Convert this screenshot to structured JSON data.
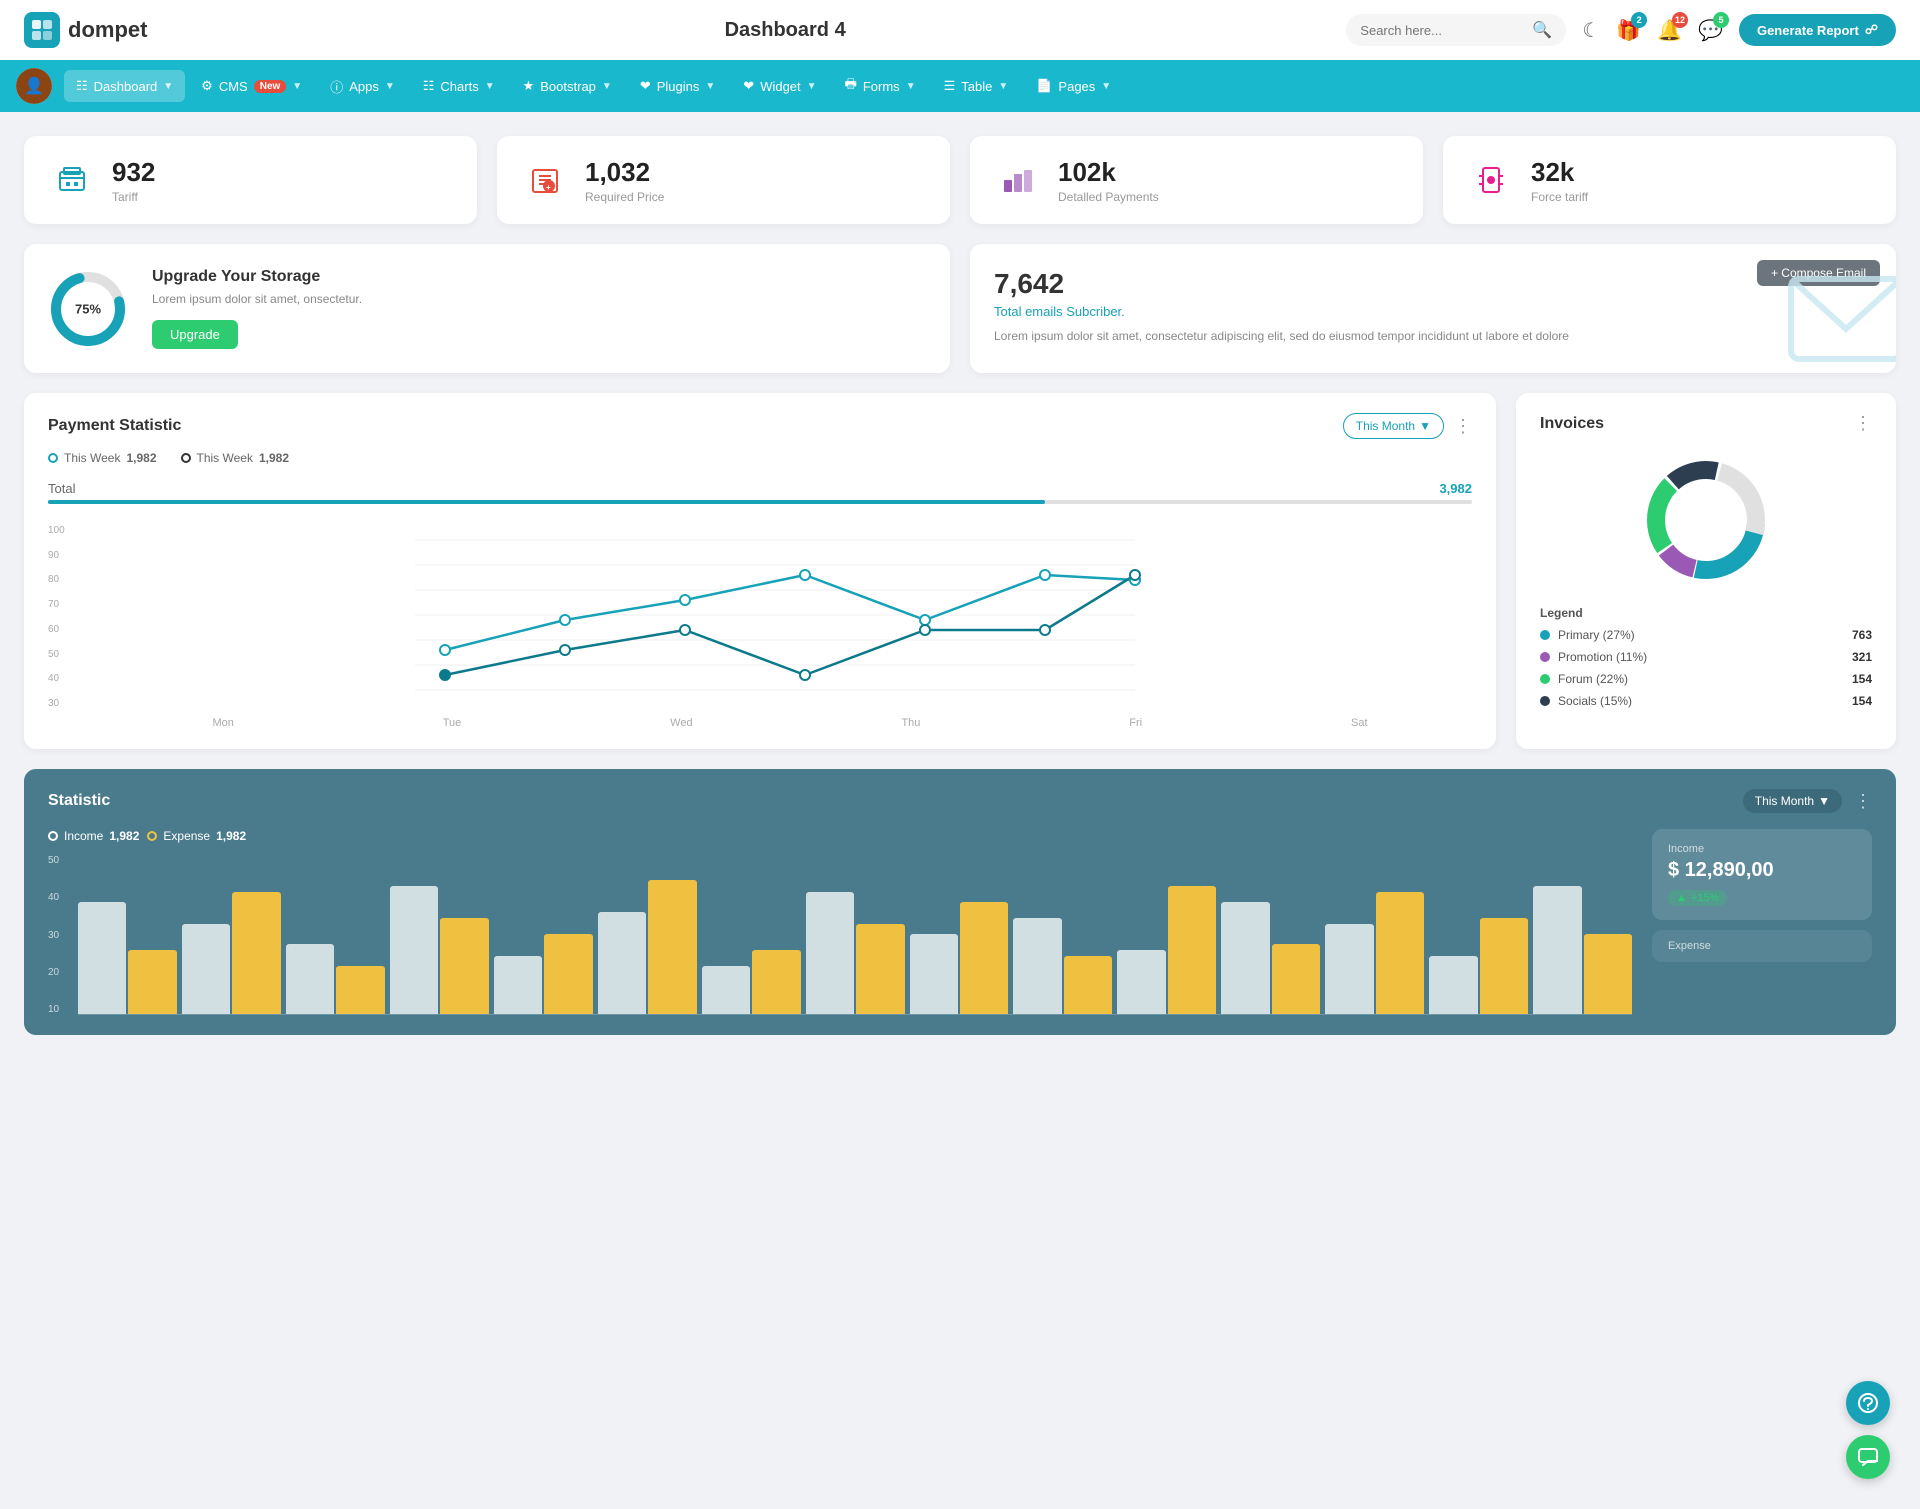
{
  "header": {
    "logo_text": "dompet",
    "title": "Dashboard 4",
    "search_placeholder": "Search here...",
    "generate_btn": "Generate Report",
    "icons": {
      "theme": "🌙",
      "gift_badge": "2",
      "bell_badge": "12",
      "chat_badge": "5"
    }
  },
  "navbar": {
    "items": [
      {
        "label": "Dashboard",
        "icon": "grid",
        "active": true,
        "has_arrow": true
      },
      {
        "label": "CMS",
        "icon": "gear",
        "badge": "New",
        "has_arrow": true
      },
      {
        "label": "Apps",
        "icon": "info",
        "has_arrow": true
      },
      {
        "label": "Charts",
        "icon": "chart",
        "has_arrow": true
      },
      {
        "label": "Bootstrap",
        "icon": "star",
        "has_arrow": true
      },
      {
        "label": "Plugins",
        "icon": "heart",
        "has_arrow": true
      },
      {
        "label": "Widget",
        "icon": "heart",
        "has_arrow": true
      },
      {
        "label": "Forms",
        "icon": "print",
        "has_arrow": true
      },
      {
        "label": "Table",
        "icon": "table",
        "has_arrow": true
      },
      {
        "label": "Pages",
        "icon": "page",
        "has_arrow": true
      }
    ]
  },
  "stats": [
    {
      "value": "932",
      "label": "Tariff",
      "icon": "🏢",
      "icon_class": "teal"
    },
    {
      "value": "1,032",
      "label": "Required Price",
      "icon": "📋",
      "icon_class": "red"
    },
    {
      "value": "102k",
      "label": "Detalled Payments",
      "icon": "📊",
      "icon_class": "purple"
    },
    {
      "value": "32k",
      "label": "Force tariff",
      "icon": "🏬",
      "icon_class": "pink"
    }
  ],
  "storage": {
    "percent": "75%",
    "percent_num": 75,
    "title": "Upgrade Your Storage",
    "description": "Lorem ipsum dolor sit amet, onsectetur.",
    "button_label": "Upgrade"
  },
  "email": {
    "count": "7,642",
    "subtitle": "Total emails Subcriber.",
    "description": "Lorem ipsum dolor sit amet, consectetur adipiscing elit, sed do eiusmod tempor incididunt ut labore et dolore",
    "compose_btn": "+ Compose Email"
  },
  "payment": {
    "title": "Payment Statistic",
    "filter": "This Month",
    "legend1_label": "This Week",
    "legend1_value": "1,982",
    "legend2_label": "This Week",
    "legend2_value": "1,982",
    "total_label": "Total",
    "total_value": "3,982",
    "y_labels": [
      "100",
      "90",
      "80",
      "70",
      "60",
      "50",
      "40",
      "30"
    ],
    "x_labels": [
      "Mon",
      "Tue",
      "Wed",
      "Thu",
      "Fri",
      "Sat"
    ],
    "line1_points": "40,140 130,100 220,80 310,60 400,100 490,105 580,55 670,60",
    "line2_points": "40,160 130,140 220,120 310,160 400,120 490,115 580,60 670,60"
  },
  "invoices": {
    "title": "Invoices",
    "donut": [
      {
        "label": "Primary (27%)",
        "value": "763",
        "color": "#17a2b8",
        "percent": 27
      },
      {
        "label": "Promotion (11%)",
        "value": "321",
        "color": "#9b59b6",
        "percent": 11
      },
      {
        "label": "Forum (22%)",
        "value": "154",
        "color": "#2ecc71",
        "percent": 22
      },
      {
        "label": "Socials (15%)",
        "value": "154",
        "color": "#2c3e50",
        "percent": 15
      }
    ]
  },
  "statistic": {
    "title": "Statistic",
    "filter": "This Month",
    "income_label": "Income",
    "income_value": "1,982",
    "expense_label": "Expense",
    "expense_value": "1,982",
    "income_box_label": "Income",
    "income_box_value": "$ 12,890,00",
    "income_badge": "+15%",
    "expense_box_label": "Expense",
    "y_labels": [
      "50",
      "40",
      "30",
      "20",
      "10"
    ],
    "bar_data": [
      {
        "white": 35,
        "yellow": 20
      },
      {
        "white": 28,
        "yellow": 38
      },
      {
        "white": 22,
        "yellow": 15
      },
      {
        "white": 40,
        "yellow": 30
      },
      {
        "white": 18,
        "yellow": 25
      },
      {
        "white": 32,
        "yellow": 42
      },
      {
        "white": 15,
        "yellow": 20
      },
      {
        "white": 38,
        "yellow": 28
      },
      {
        "white": 25,
        "yellow": 35
      },
      {
        "white": 30,
        "yellow": 18
      },
      {
        "white": 20,
        "yellow": 40
      },
      {
        "white": 35,
        "yellow": 22
      },
      {
        "white": 28,
        "yellow": 38
      },
      {
        "white": 18,
        "yellow": 30
      },
      {
        "white": 40,
        "yellow": 25
      }
    ]
  },
  "colors": {
    "primary": "#17a2b8",
    "navbar_bg": "#1ab8cc",
    "stat_bg": "#4a7b8c"
  }
}
